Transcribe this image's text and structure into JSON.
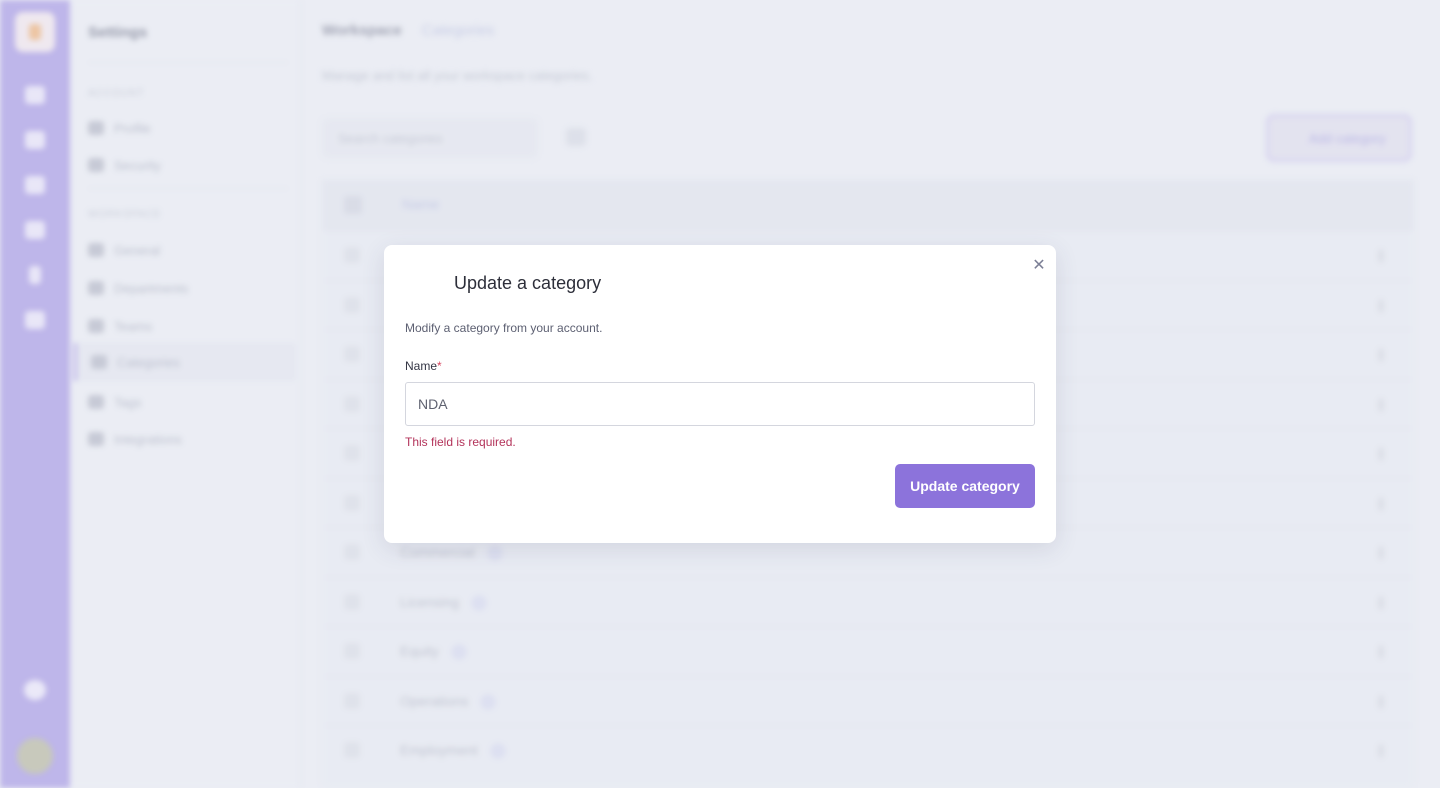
{
  "background": {
    "settings_title": "Settings",
    "sections": [
      {
        "heading": "ACCOUNT",
        "items": [
          "Profile",
          "Security"
        ]
      },
      {
        "heading": "WORKSPACE",
        "items": [
          "General",
          "Departments",
          "Teams",
          "Categories",
          "Tags",
          "Integrations"
        ]
      }
    ],
    "breadcrumb": {
      "root": "Workspace",
      "current": "Categories"
    },
    "description": "Manage and list all your workspace categories.",
    "search_placeholder": "Search categories",
    "add_button": "Add category",
    "table_header": "Name",
    "rows": [
      "",
      "",
      "",
      "",
      "",
      "",
      "Commercial",
      "Licensing",
      "Equity",
      "Operations",
      "Employment"
    ]
  },
  "modal": {
    "title": "Update a category",
    "subtitle": "Modify a category from your account.",
    "field_label": "Name",
    "required_mark": "*",
    "field_value": "NDA",
    "error": "This field is required.",
    "submit_label": "Update category",
    "close_glyph": "✕"
  },
  "colors": {
    "accent": "#8c73db",
    "rail": "#a99be6",
    "error": "#b3335a"
  }
}
